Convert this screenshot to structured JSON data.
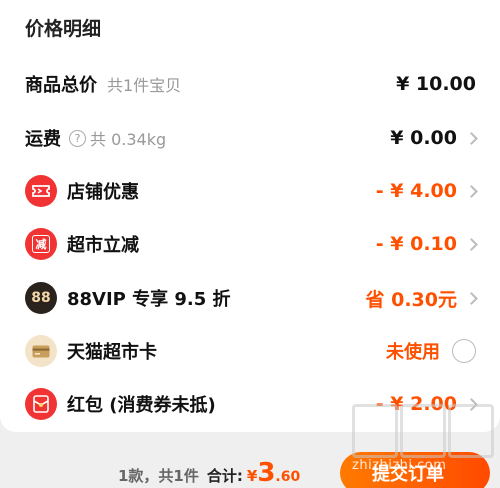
{
  "card": {
    "title": "价格明细"
  },
  "rows": [
    {
      "label": "商品总价",
      "sub": "共1件宝贝",
      "amount": "¥ 10.00",
      "orange": false,
      "chev": false
    },
    {
      "label": "运费",
      "sub": "共 0.34kg",
      "amount": "¥ 0.00",
      "orange": false,
      "chev": true
    },
    {
      "label": "店铺优惠",
      "amount": "- ¥ 4.00",
      "orange": true,
      "chev": true,
      "icon": "ticket-icon"
    },
    {
      "label": "超市立减",
      "amount": "- ¥ 0.10",
      "orange": true,
      "chev": true,
      "icon": "minus-stamp-icon",
      "icon_text": "减"
    },
    {
      "label": "88VIP 专享 9.5 折",
      "amount": "省 0.30元",
      "orange": true,
      "chev": true,
      "icon": "vip-88-icon",
      "icon_text": "88"
    },
    {
      "label": "天猫超市卡",
      "amount": "未使用",
      "orange": true,
      "chev": false,
      "icon": "card-icon"
    },
    {
      "label": "红包 (消费券未抵)",
      "amount": "- ¥ 2.00",
      "orange": true,
      "chev": true,
      "icon": "red-envelope-icon"
    }
  ],
  "footer": {
    "count": "1款，共1件",
    "total_label": "合计:",
    "currency": "¥",
    "total_int": "3",
    "total_dec": ".60",
    "submit_label": "提交订单"
  },
  "watermark": "zhizhizhi.com",
  "colors": {
    "accent": "#ff5000",
    "badge_red": "#f23333",
    "badge_dark": "#2a221c"
  }
}
